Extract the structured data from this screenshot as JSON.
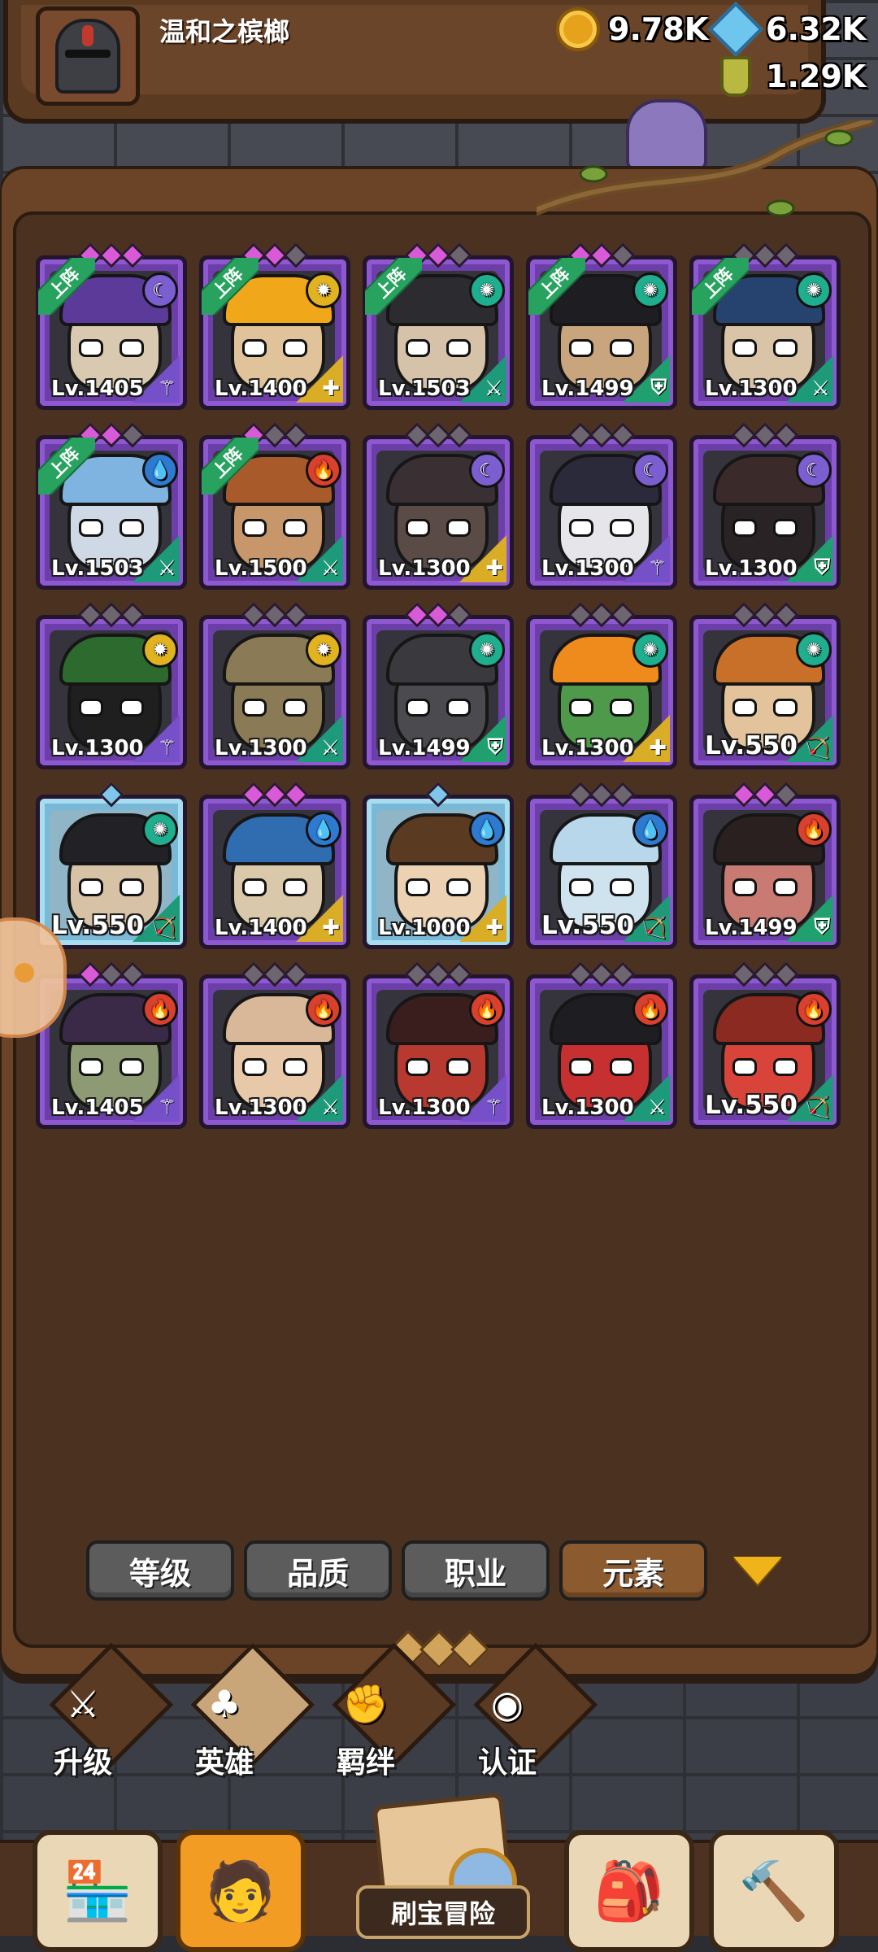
{
  "player": {
    "name": "温和之槟榔"
  },
  "resources": {
    "gold": "9.78K",
    "gems": "6.32K",
    "potion": "1.29K"
  },
  "deployed_label": "上阵",
  "heroes": [
    {
      "level": "Lv.1405",
      "deployed": true,
      "element": "moon",
      "role": "mage",
      "stars": [
        "on",
        "on",
        "on"
      ],
      "frame": "purple",
      "skin": "#d8c9b0",
      "hat": "#5b3a9a"
    },
    {
      "level": "Lv.1400",
      "deployed": true,
      "element": "sun",
      "role": "priest",
      "stars": [
        "on",
        "on",
        "off"
      ],
      "frame": "purple",
      "skin": "#e0c39a",
      "hat": "#f0a81a"
    },
    {
      "level": "Lv.1503",
      "deployed": true,
      "element": "wind",
      "role": "warrior",
      "stars": [
        "on",
        "on",
        "off"
      ],
      "frame": "purple",
      "skin": "#d6c2a8",
      "hat": "#2c2c30"
    },
    {
      "level": "Lv.1499",
      "deployed": true,
      "element": "wind",
      "role": "tank",
      "stars": [
        "on",
        "on",
        "off"
      ],
      "frame": "purple",
      "skin": "#c9a57e",
      "hat": "#1e1e22"
    },
    {
      "level": "Lv.1300",
      "deployed": true,
      "element": "wind",
      "role": "warrior",
      "stars": [
        "off",
        "off",
        "off"
      ],
      "frame": "purple",
      "skin": "#d9c4a8",
      "hat": "#26426e"
    },
    {
      "level": "Lv.1503",
      "deployed": true,
      "element": "water",
      "role": "warrior",
      "stars": [
        "on",
        "on",
        "off"
      ],
      "frame": "purple",
      "skin": "#cfd9e6",
      "hat": "#7fb3e0"
    },
    {
      "level": "Lv.1500",
      "deployed": true,
      "element": "fire",
      "role": "warrior",
      "stars": [
        "on",
        "off",
        "off"
      ],
      "frame": "purple",
      "skin": "#c7966b",
      "hat": "#a85a2a"
    },
    {
      "level": "Lv.1300",
      "deployed": false,
      "element": "moon",
      "role": "priest",
      "stars": [
        "off",
        "off",
        "off"
      ],
      "frame": "purple",
      "skin": "#5a4b46",
      "hat": "#3a3034"
    },
    {
      "level": "Lv.1300",
      "deployed": false,
      "element": "moon",
      "role": "mage",
      "stars": [
        "off",
        "off",
        "off"
      ],
      "frame": "purple",
      "skin": "#e6e6ea",
      "hat": "#2a2a3a"
    },
    {
      "level": "Lv.1300",
      "deployed": false,
      "element": "moon",
      "role": "tank",
      "stars": [
        "off",
        "off",
        "off"
      ],
      "frame": "purple",
      "skin": "#2a2326",
      "hat": "#3b2a2a"
    },
    {
      "level": "Lv.1300",
      "deployed": false,
      "element": "sun",
      "role": "mage",
      "stars": [
        "off",
        "off",
        "off"
      ],
      "frame": "purple",
      "skin": "#1f1f1f",
      "hat": "#2d6a2d"
    },
    {
      "level": "Lv.1300",
      "deployed": false,
      "element": "sun",
      "role": "warrior",
      "stars": [
        "off",
        "off",
        "off"
      ],
      "frame": "purple",
      "skin": "#8a7a55",
      "hat": "#8a7a55"
    },
    {
      "level": "Lv.1499",
      "deployed": false,
      "element": "wind",
      "role": "tank",
      "stars": [
        "on",
        "on",
        "off"
      ],
      "frame": "purple",
      "skin": "#4b4b4f",
      "hat": "#3a3a3e"
    },
    {
      "level": "Lv.1300",
      "deployed": false,
      "element": "wind",
      "role": "priest",
      "stars": [
        "off",
        "off",
        "off"
      ],
      "frame": "purple",
      "skin": "#4f9a4a",
      "hat": "#ef8a1c"
    },
    {
      "level": "Lv.550",
      "deployed": false,
      "element": "wind",
      "role": "archer",
      "stars": [
        "off",
        "off",
        "off"
      ],
      "frame": "purple",
      "skin": "#e2c39b",
      "hat": "#c8702a"
    },
    {
      "level": "Lv.550",
      "deployed": false,
      "element": "wind",
      "role": "archer",
      "stars": [
        "blue"
      ],
      "frame": "blue",
      "skin": "#d8c2a6",
      "hat": "#222226"
    },
    {
      "level": "Lv.1400",
      "deployed": false,
      "element": "water",
      "role": "priest",
      "stars": [
        "on",
        "on",
        "on"
      ],
      "frame": "purple",
      "skin": "#d9c8a9",
      "hat": "#2f6cb0"
    },
    {
      "level": "Lv.1000",
      "deployed": false,
      "element": "water",
      "role": "priest",
      "stars": [
        "blue"
      ],
      "frame": "blue",
      "skin": "#ecd2b3",
      "hat": "#5a3a20"
    },
    {
      "level": "Lv.550",
      "deployed": false,
      "element": "water",
      "role": "archer",
      "stars": [
        "off",
        "off",
        "off"
      ],
      "frame": "purple",
      "skin": "#cfe3ee",
      "hat": "#b8d7ea"
    },
    {
      "level": "Lv.1499",
      "deployed": false,
      "element": "fire",
      "role": "tank",
      "stars": [
        "on",
        "on",
        "off"
      ],
      "frame": "purple",
      "skin": "#c97a72",
      "hat": "#2a2020"
    },
    {
      "level": "Lv.1405",
      "deployed": false,
      "element": "fire",
      "role": "mage",
      "stars": [
        "on",
        "off",
        "off"
      ],
      "frame": "purple",
      "skin": "#8e9a74",
      "hat": "#3a2a48"
    },
    {
      "level": "Lv.1300",
      "deployed": false,
      "element": "fire",
      "role": "warrior",
      "stars": [
        "off",
        "off",
        "off"
      ],
      "frame": "purple",
      "skin": "#e7c8a8",
      "hat": "#d8b898"
    },
    {
      "level": "Lv.1300",
      "deployed": false,
      "element": "fire",
      "role": "mage",
      "stars": [
        "off",
        "off",
        "off"
      ],
      "frame": "purple",
      "skin": "#b8392f",
      "hat": "#3a1e1e"
    },
    {
      "level": "Lv.1300",
      "deployed": false,
      "element": "fire",
      "role": "warrior",
      "stars": [
        "off",
        "off",
        "off"
      ],
      "frame": "purple",
      "skin": "#c73030",
      "hat": "#1e1e22"
    },
    {
      "level": "Lv.550",
      "deployed": false,
      "element": "fire",
      "role": "archer",
      "stars": [
        "off",
        "off",
        "off"
      ],
      "frame": "purple",
      "skin": "#d8443a",
      "hat": "#8a2a20"
    }
  ],
  "sort_tabs": [
    {
      "label": "等级",
      "active": false
    },
    {
      "label": "品质",
      "active": false
    },
    {
      "label": "职业",
      "active": false
    },
    {
      "label": "元素",
      "active": true
    }
  ],
  "sub_tabs": [
    {
      "label": "升级",
      "icon": "⚔",
      "active": false
    },
    {
      "label": "英雄",
      "icon": "♣",
      "active": true
    },
    {
      "label": "羁绊",
      "icon": "✊",
      "active": false
    },
    {
      "label": "认证",
      "icon": "◉",
      "active": false
    }
  ],
  "bottom_nav": {
    "shop_icon": "shop-icon",
    "heroes_icon": "hero-icon",
    "adventure_label": "刷宝冒险",
    "chest_icon": "chest-icon",
    "forge_icon": "forge-icon"
  },
  "colors": {
    "element": {
      "moon": "#7b5fd1",
      "sun": "#e2b321",
      "wind": "#1fae8e",
      "water": "#2e7ad1",
      "fire": "#d9402e"
    },
    "role": {
      "mage": "#7550c8",
      "priest": "#d9ad25",
      "warrior": "#1d9a7a",
      "tank": "#1fa06e",
      "archer": "#1e9a78"
    }
  }
}
